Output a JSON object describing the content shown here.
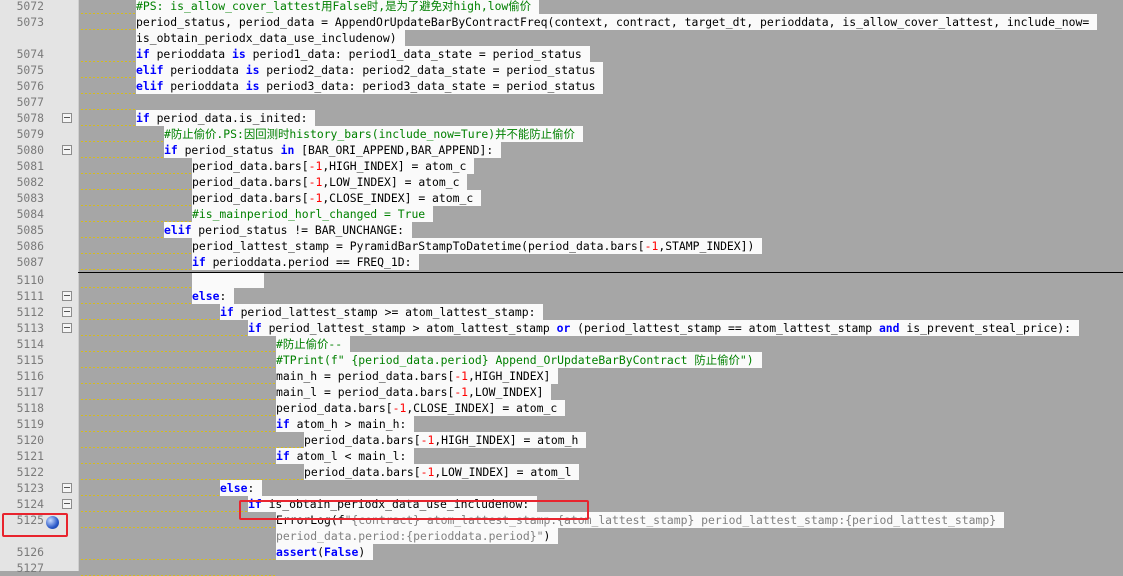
{
  "editor": {
    "lines": [
      {
        "n": "5072",
        "parts": [
          {
            "t": "#PS: is_allow_cover_lattest用False时,是为了避免对high,low偷价",
            "c": "cm"
          }
        ]
      },
      {
        "n": "5073",
        "parts": [
          {
            "t": "period_status, period_data = AppendOrUpdateBarByContractFreq(context, contract, target_dt, perioddata, is_allow_cover_lattest, include_now=",
            "c": ""
          }
        ]
      },
      {
        "n": "",
        "parts": [
          {
            "t": "is_obtain_periodx_data_use_includenow)",
            "c": ""
          }
        ]
      },
      {
        "n": "5074",
        "parts": [
          {
            "t": "if",
            "c": "kw"
          },
          {
            "t": " perioddata ",
            "c": ""
          },
          {
            "t": "is",
            "c": "kw"
          },
          {
            "t": " period1_data: period1_data_state = period_status",
            "c": ""
          }
        ]
      },
      {
        "n": "5075",
        "parts": [
          {
            "t": "elif",
            "c": "kw"
          },
          {
            "t": " perioddata ",
            "c": ""
          },
          {
            "t": "is",
            "c": "kw"
          },
          {
            "t": " period2_data: period2_data_state = period_status",
            "c": ""
          }
        ]
      },
      {
        "n": "5076",
        "parts": [
          {
            "t": "elif",
            "c": "kw"
          },
          {
            "t": " perioddata ",
            "c": ""
          },
          {
            "t": "is",
            "c": "kw"
          },
          {
            "t": " period3_data: period3_data_state = period_status",
            "c": ""
          }
        ]
      },
      {
        "n": "5077",
        "parts": []
      },
      {
        "n": "5078",
        "parts": [
          {
            "t": "if",
            "c": "kw"
          },
          {
            "t": " period_data.is_inited:",
            "c": ""
          }
        ]
      },
      {
        "n": "5079",
        "parts": [
          {
            "t": "#防止偷价.PS:因回测时history_bars(include_now=Ture)并不能防止偷价",
            "c": "cm"
          }
        ]
      },
      {
        "n": "5080",
        "parts": [
          {
            "t": "if",
            "c": "kw"
          },
          {
            "t": " period_status ",
            "c": ""
          },
          {
            "t": "in",
            "c": "kw"
          },
          {
            "t": " [BAR_ORI_APPEND,BAR_APPEND]:",
            "c": ""
          }
        ]
      },
      {
        "n": "5081",
        "parts": [
          {
            "t": "period_data.bars[",
            "c": ""
          },
          {
            "t": "-1",
            "c": "num"
          },
          {
            "t": ",HIGH_INDEX] = atom_c",
            "c": ""
          }
        ]
      },
      {
        "n": "5082",
        "parts": [
          {
            "t": "period_data.bars[",
            "c": ""
          },
          {
            "t": "-1",
            "c": "num"
          },
          {
            "t": ",LOW_INDEX] = atom_c",
            "c": ""
          }
        ]
      },
      {
        "n": "5083",
        "parts": [
          {
            "t": "period_data.bars[",
            "c": ""
          },
          {
            "t": "-1",
            "c": "num"
          },
          {
            "t": ",CLOSE_INDEX] = atom_c",
            "c": ""
          }
        ]
      },
      {
        "n": "5084",
        "parts": [
          {
            "t": "#is_mainperiod_horl_changed = True",
            "c": "cm"
          }
        ]
      },
      {
        "n": "5085",
        "parts": [
          {
            "t": "elif",
            "c": "kw"
          },
          {
            "t": " period_status != BAR_UNCHANGE:",
            "c": ""
          }
        ]
      },
      {
        "n": "5086",
        "parts": [
          {
            "t": "period_lattest_stamp = PyramidBarStampToDatetime(period_data.bars[",
            "c": ""
          },
          {
            "t": "-1",
            "c": "num"
          },
          {
            "t": ",STAMP_INDEX])",
            "c": ""
          }
        ]
      },
      {
        "n": "5087",
        "parts": [
          {
            "t": "if",
            "c": "kw"
          },
          {
            "t": " perioddata.period == FREQ_1D:",
            "c": ""
          }
        ]
      },
      {
        "n": "5110",
        "parts": []
      },
      {
        "n": "5111",
        "parts": [
          {
            "t": "else",
            "c": "kw"
          },
          {
            "t": ":",
            "c": ""
          }
        ]
      },
      {
        "n": "5112",
        "parts": [
          {
            "t": "if",
            "c": "kw"
          },
          {
            "t": " period_lattest_stamp >= atom_lattest_stamp:",
            "c": ""
          }
        ]
      },
      {
        "n": "5113",
        "parts": [
          {
            "t": "if",
            "c": "kw"
          },
          {
            "t": " period_lattest_stamp > atom_lattest_stamp ",
            "c": ""
          },
          {
            "t": "or",
            "c": "kw"
          },
          {
            "t": " (period_lattest_stamp == atom_lattest_stamp ",
            "c": ""
          },
          {
            "t": "and",
            "c": "kw"
          },
          {
            "t": " is_prevent_steal_price):",
            "c": ""
          }
        ]
      },
      {
        "n": "5114",
        "parts": [
          {
            "t": "#防止偷价--",
            "c": "cm"
          }
        ]
      },
      {
        "n": "5115",
        "parts": [
          {
            "t": "#TPrint(f\" {period_data.period} Append_OrUpdateBarByContract 防止偷价\")",
            "c": "cm"
          }
        ]
      },
      {
        "n": "5116",
        "parts": [
          {
            "t": "main_h = period_data.bars[",
            "c": ""
          },
          {
            "t": "-1",
            "c": "num"
          },
          {
            "t": ",HIGH_INDEX]",
            "c": ""
          }
        ]
      },
      {
        "n": "5117",
        "parts": [
          {
            "t": "main_l = period_data.bars[",
            "c": ""
          },
          {
            "t": "-1",
            "c": "num"
          },
          {
            "t": ",LOW_INDEX]",
            "c": ""
          }
        ]
      },
      {
        "n": "5118",
        "parts": [
          {
            "t": "period_data.bars[",
            "c": ""
          },
          {
            "t": "-1",
            "c": "num"
          },
          {
            "t": ",CLOSE_INDEX] = atom_c",
            "c": ""
          }
        ]
      },
      {
        "n": "5119",
        "parts": [
          {
            "t": "if",
            "c": "kw"
          },
          {
            "t": " atom_h > main_h:",
            "c": ""
          }
        ]
      },
      {
        "n": "5120",
        "parts": [
          {
            "t": "period_data.bars[",
            "c": ""
          },
          {
            "t": "-1",
            "c": "num"
          },
          {
            "t": ",HIGH_INDEX] = atom_h",
            "c": ""
          }
        ]
      },
      {
        "n": "5121",
        "parts": [
          {
            "t": "if",
            "c": "kw"
          },
          {
            "t": " atom_l < main_l:",
            "c": ""
          }
        ]
      },
      {
        "n": "5122",
        "parts": [
          {
            "t": "period_data.bars[",
            "c": ""
          },
          {
            "t": "-1",
            "c": "num"
          },
          {
            "t": ",LOW_INDEX] = atom_l",
            "c": ""
          }
        ]
      },
      {
        "n": "5123",
        "parts": [
          {
            "t": "else",
            "c": "kw"
          },
          {
            "t": ":",
            "c": ""
          }
        ]
      },
      {
        "n": "5124",
        "parts": [
          {
            "t": "if",
            "c": "kw"
          },
          {
            "t": " is_obtain_periodx_data_use_includenow:",
            "c": ""
          }
        ]
      },
      {
        "n": "5125",
        "parts": [
          {
            "t": "ErrorLog(f",
            "c": ""
          },
          {
            "t": "\"{contract} atom_lattest_stamp:{atom_lattest_stamp} period_lattest_stamp:{period_lattest_stamp}",
            "c": "str"
          }
        ]
      },
      {
        "n": "",
        "parts": [
          {
            "t": "period_data.period:{perioddata.period}\"",
            "c": "str"
          },
          {
            "t": ")",
            "c": ""
          }
        ]
      },
      {
        "n": "5126",
        "parts": [
          {
            "t": "assert",
            "c": "kw"
          },
          {
            "t": "(",
            "c": ""
          },
          {
            "t": "False",
            "c": "kw"
          },
          {
            "t": ")",
            "c": ""
          }
        ]
      },
      {
        "n": "5127",
        "parts": []
      }
    ]
  }
}
